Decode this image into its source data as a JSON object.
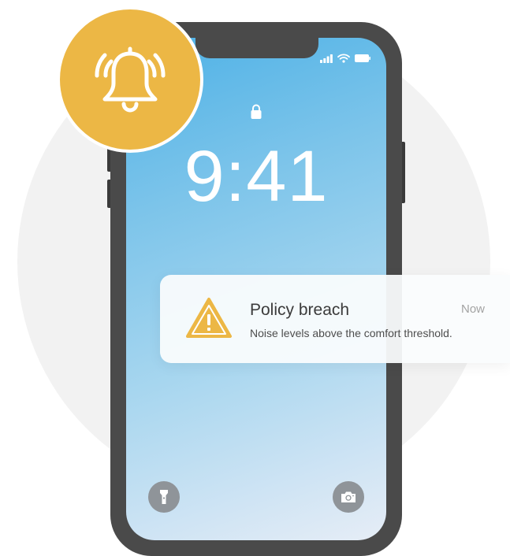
{
  "lock_screen": {
    "time": "9:41"
  },
  "notification": {
    "title": "Policy breach",
    "body": "Noise levels above the comfort threshold.",
    "time": "Now",
    "icon": "warning-icon"
  },
  "icons": {
    "badge": "alarm-bell-icon",
    "status": [
      "signal-icon",
      "wifi-icon",
      "battery-icon"
    ],
    "lock": "lock-icon",
    "bottom_left": "flashlight-icon",
    "bottom_right": "camera-icon"
  },
  "colors": {
    "badge": "#ecb745",
    "warning": "#ecb745",
    "phone_frame": "#4a4a4a",
    "screen_top": "#4db1e6",
    "screen_bottom": "#e6edf6"
  }
}
